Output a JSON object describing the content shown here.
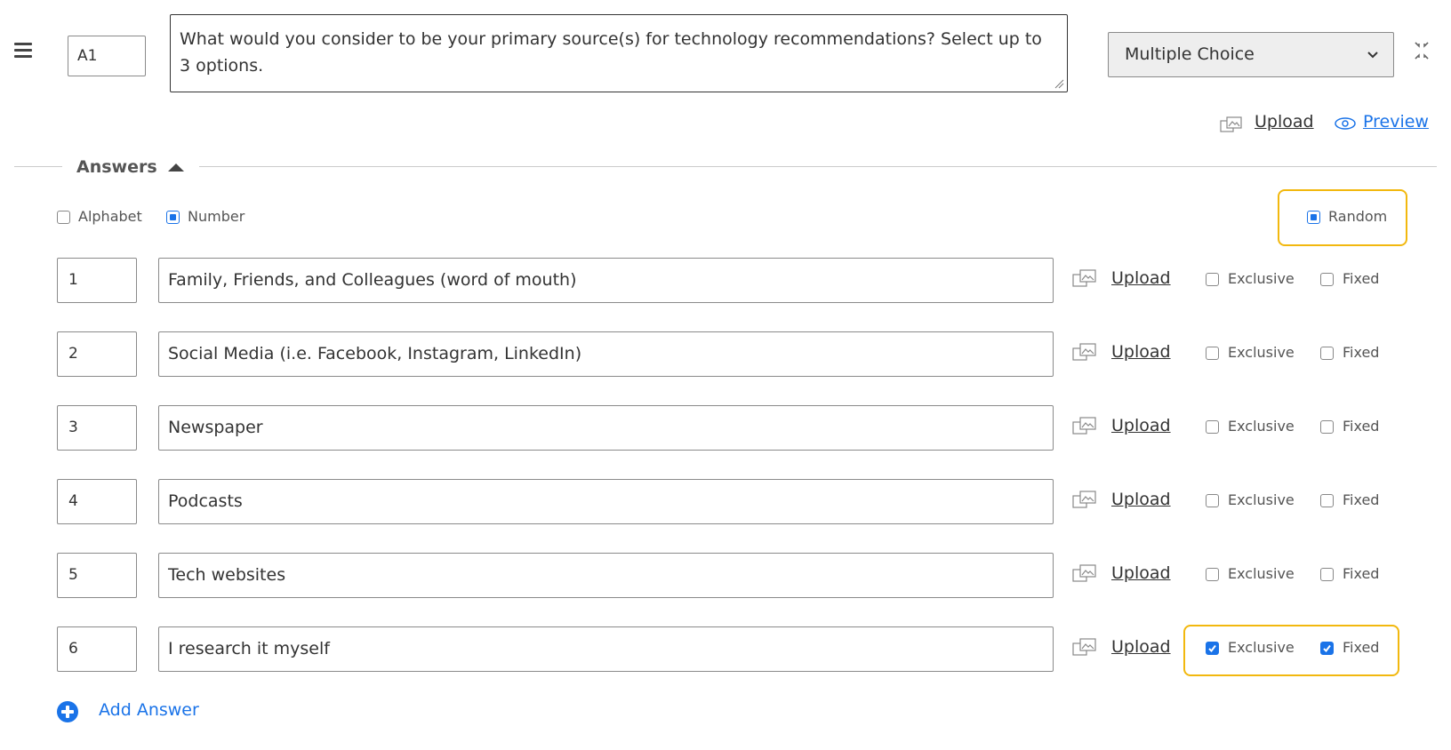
{
  "header": {
    "code": "A1",
    "question": "What would you consider to be your primary source(s) for technology recommendations? Select up to 3 options.",
    "question_type": "Multiple Choice",
    "upload_label": "Upload",
    "preview_label": "Preview"
  },
  "answers_section": {
    "label": "Answers",
    "labeling": {
      "alphabet_label": "Alphabet",
      "alphabet_checked": false,
      "number_label": "Number",
      "number_checked": true
    },
    "random_label": "Random",
    "random_checked": true
  },
  "answers": [
    {
      "number": "1",
      "text": "Family, Friends, and Colleagues (word of mouth)",
      "upload": "Upload",
      "exclusive_label": "Exclusive",
      "exclusive": false,
      "fixed_label": "Fixed",
      "fixed": false
    },
    {
      "number": "2",
      "text": "Social Media (i.e. Facebook, Instagram, LinkedIn)",
      "upload": "Upload",
      "exclusive_label": "Exclusive",
      "exclusive": false,
      "fixed_label": "Fixed",
      "fixed": false
    },
    {
      "number": "3",
      "text": "Newspaper",
      "upload": "Upload",
      "exclusive_label": "Exclusive",
      "exclusive": false,
      "fixed_label": "Fixed",
      "fixed": false
    },
    {
      "number": "4",
      "text": "Podcasts",
      "upload": "Upload",
      "exclusive_label": "Exclusive",
      "exclusive": false,
      "fixed_label": "Fixed",
      "fixed": false
    },
    {
      "number": "5",
      "text": "Tech websites",
      "upload": "Upload",
      "exclusive_label": "Exclusive",
      "exclusive": false,
      "fixed_label": "Fixed",
      "fixed": false
    },
    {
      "number": "6",
      "text": "I research it myself",
      "upload": "Upload",
      "exclusive_label": "Exclusive",
      "exclusive": true,
      "fixed_label": "Fixed",
      "fixed": true
    }
  ],
  "add_answer_label": "Add Answer",
  "colors": {
    "accent": "#1a73e8",
    "highlight": "#f2b80e"
  },
  "icons": {
    "menu": "hamburger-icon",
    "collapse": "collapse-arrows-icon",
    "upload": "image-upload-icon",
    "preview": "eye-icon",
    "section_toggle": "caret-up-icon",
    "add": "plus-circle-icon"
  }
}
